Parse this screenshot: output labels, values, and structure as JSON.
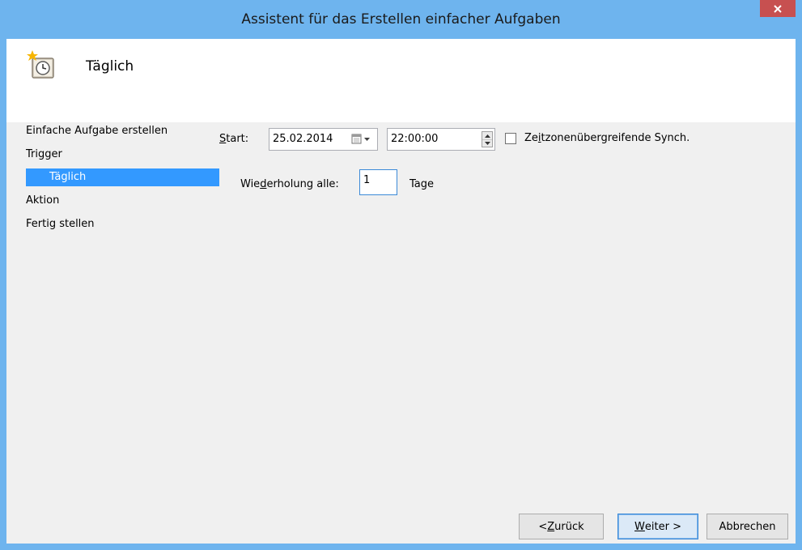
{
  "window": {
    "title": "Assistent für das Erstellen einfacher Aufgaben",
    "close_glyph": "✕"
  },
  "header": {
    "icon": "task-scheduler-clock-icon",
    "title": "Täglich"
  },
  "nav": {
    "items": [
      {
        "label": "Einfache Aufgabe erstellen",
        "selected": false
      },
      {
        "label": "Trigger",
        "selected": false
      },
      {
        "label": "Täglich",
        "selected": true
      },
      {
        "label": "Aktion",
        "selected": false
      },
      {
        "label": "Fertig stellen",
        "selected": false
      }
    ]
  },
  "form": {
    "start_label_access": "S",
    "start_label_rest": "tart:",
    "start_date": "25.02.2014",
    "start_time": "22:00:00",
    "sync_label_pre": "Ze",
    "sync_label_access": "i",
    "sync_label_post": "tzonenübergreifende Synch.",
    "sync_checked": false,
    "repeat_label_pre": "Wie",
    "repeat_label_access": "d",
    "repeat_label_post": "erholung alle:",
    "repeat_value": "1",
    "repeat_unit": "Tage"
  },
  "buttons": {
    "back_pre": "< ",
    "back_access": "Z",
    "back_post": "urück",
    "next_access": "W",
    "next_post": "eiter >",
    "cancel": "Abbrechen"
  },
  "colors": {
    "titlebar": "#6eb4ee",
    "close": "#c75050",
    "selection": "#3399ff",
    "panel": "#f0f0f0"
  }
}
